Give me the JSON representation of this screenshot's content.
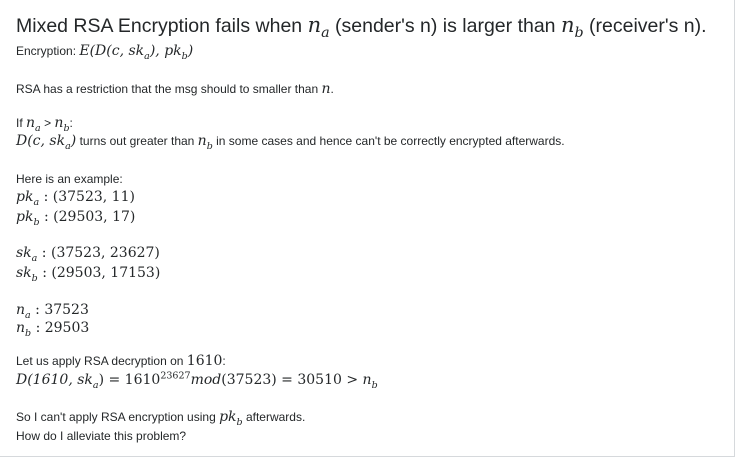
{
  "question": {
    "title_part1": "Mixed RSA Encryption fails when ",
    "title_n": "n",
    "title_sub_a": "a",
    "title_part2": " (sender's n) is larger than ",
    "title_sub_b": "b",
    "title_part3": " (receiver's n).",
    "encryption_label": "Encryption: ",
    "encryption_formula_start": "E(D(c, sk",
    "encryption_formula_mid": "), pk",
    "encryption_formula_end": ")",
    "restriction_text": "RSA has a restriction that the msg should to smaller than ",
    "restriction_var": "n",
    "restriction_period": ".",
    "if_label": "If ",
    "if_var_n": "n",
    "if_gt": " > ",
    "if_colon": ":",
    "dc_formula_start": "D(c, sk",
    "dc_formula_end": ")",
    "dc_text_mid": " turns out greater than ",
    "dc_text_end": " in some cases and hence can't be correctly encrypted afterwards.",
    "example_intro": "Here is an example:",
    "pk_a_label": "pk",
    "pk_a_value": " : (37523, 11)",
    "pk_b_label": "pk",
    "pk_b_value": " : (29503, 17)",
    "sk_a_label": "sk",
    "sk_a_value": " : (37523, 23627)",
    "sk_b_label": "sk",
    "sk_b_value": " : (29503, 17153)",
    "n_a_label": "n",
    "n_a_value": " : 37523",
    "n_b_label": "n",
    "n_b_value": " : 29503",
    "apply_text": "Let us apply RSA decryption on ",
    "apply_value": "1610",
    "apply_colon": ":",
    "decrypt_start": "D(1610, sk",
    "decrypt_mid": ") = 1610",
    "decrypt_exp": "23627",
    "decrypt_mod": "mod",
    "decrypt_end": "(37523) = 30510 > ",
    "conclusion_text": "So I can't apply RSA encryption using ",
    "conclusion_var": "pk",
    "conclusion_end": " afterwards.",
    "final_question": "How do I alleviate this problem?",
    "sub_a": "a",
    "sub_b": "b"
  }
}
